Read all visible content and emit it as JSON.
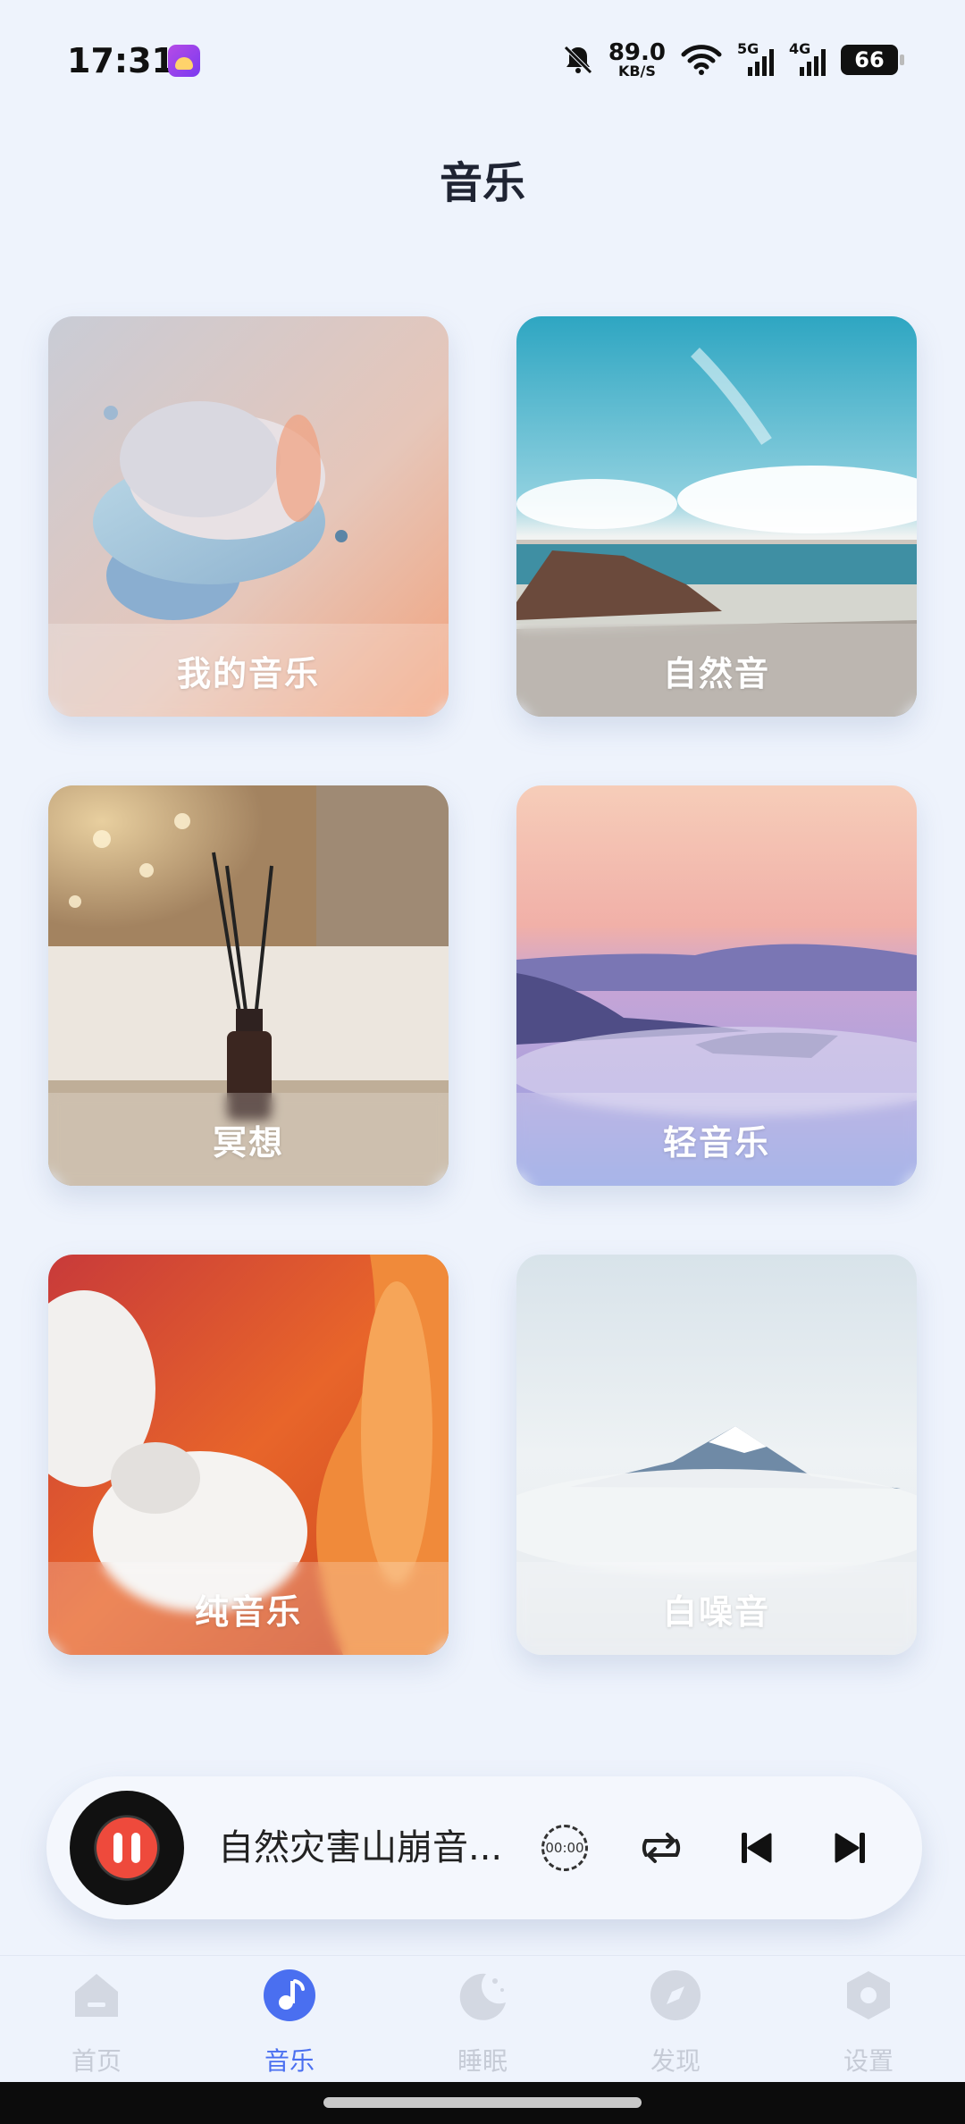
{
  "status_bar": {
    "time": "17:31",
    "net_speed_value": "89.0",
    "net_speed_unit": "KB/S",
    "signal_1_label": "5G",
    "signal_2_label": "4G",
    "battery": "66",
    "icons": [
      "app-notification-icon",
      "mute-bell-icon",
      "wifi-icon",
      "signal-icon",
      "battery-icon"
    ]
  },
  "page": {
    "title": "音乐"
  },
  "categories": [
    {
      "label": "我的音乐"
    },
    {
      "label": "自然音"
    },
    {
      "label": "冥想"
    },
    {
      "label": "轻音乐"
    },
    {
      "label": "纯音乐"
    },
    {
      "label": "白噪音"
    }
  ],
  "player": {
    "song_title": "自然灾害山崩音...",
    "timer_text": "00:00",
    "state": "playing",
    "icons": [
      "pause-icon",
      "timer-icon",
      "repeat-icon",
      "previous-icon",
      "next-icon"
    ]
  },
  "tabs": [
    {
      "label": "首页",
      "icon": "home-icon",
      "active": false
    },
    {
      "label": "音乐",
      "icon": "music-note-icon",
      "active": true
    },
    {
      "label": "睡眠",
      "icon": "moon-icon",
      "active": false
    },
    {
      "label": "发现",
      "icon": "discover-icon",
      "active": false
    },
    {
      "label": "设置",
      "icon": "settings-hexagon-icon",
      "active": false
    }
  ],
  "colors": {
    "background": "#eef3fc",
    "accent": "#4a6ff0",
    "pause_button": "#ee4a3c",
    "tab_inactive": "#c6cbd6"
  }
}
